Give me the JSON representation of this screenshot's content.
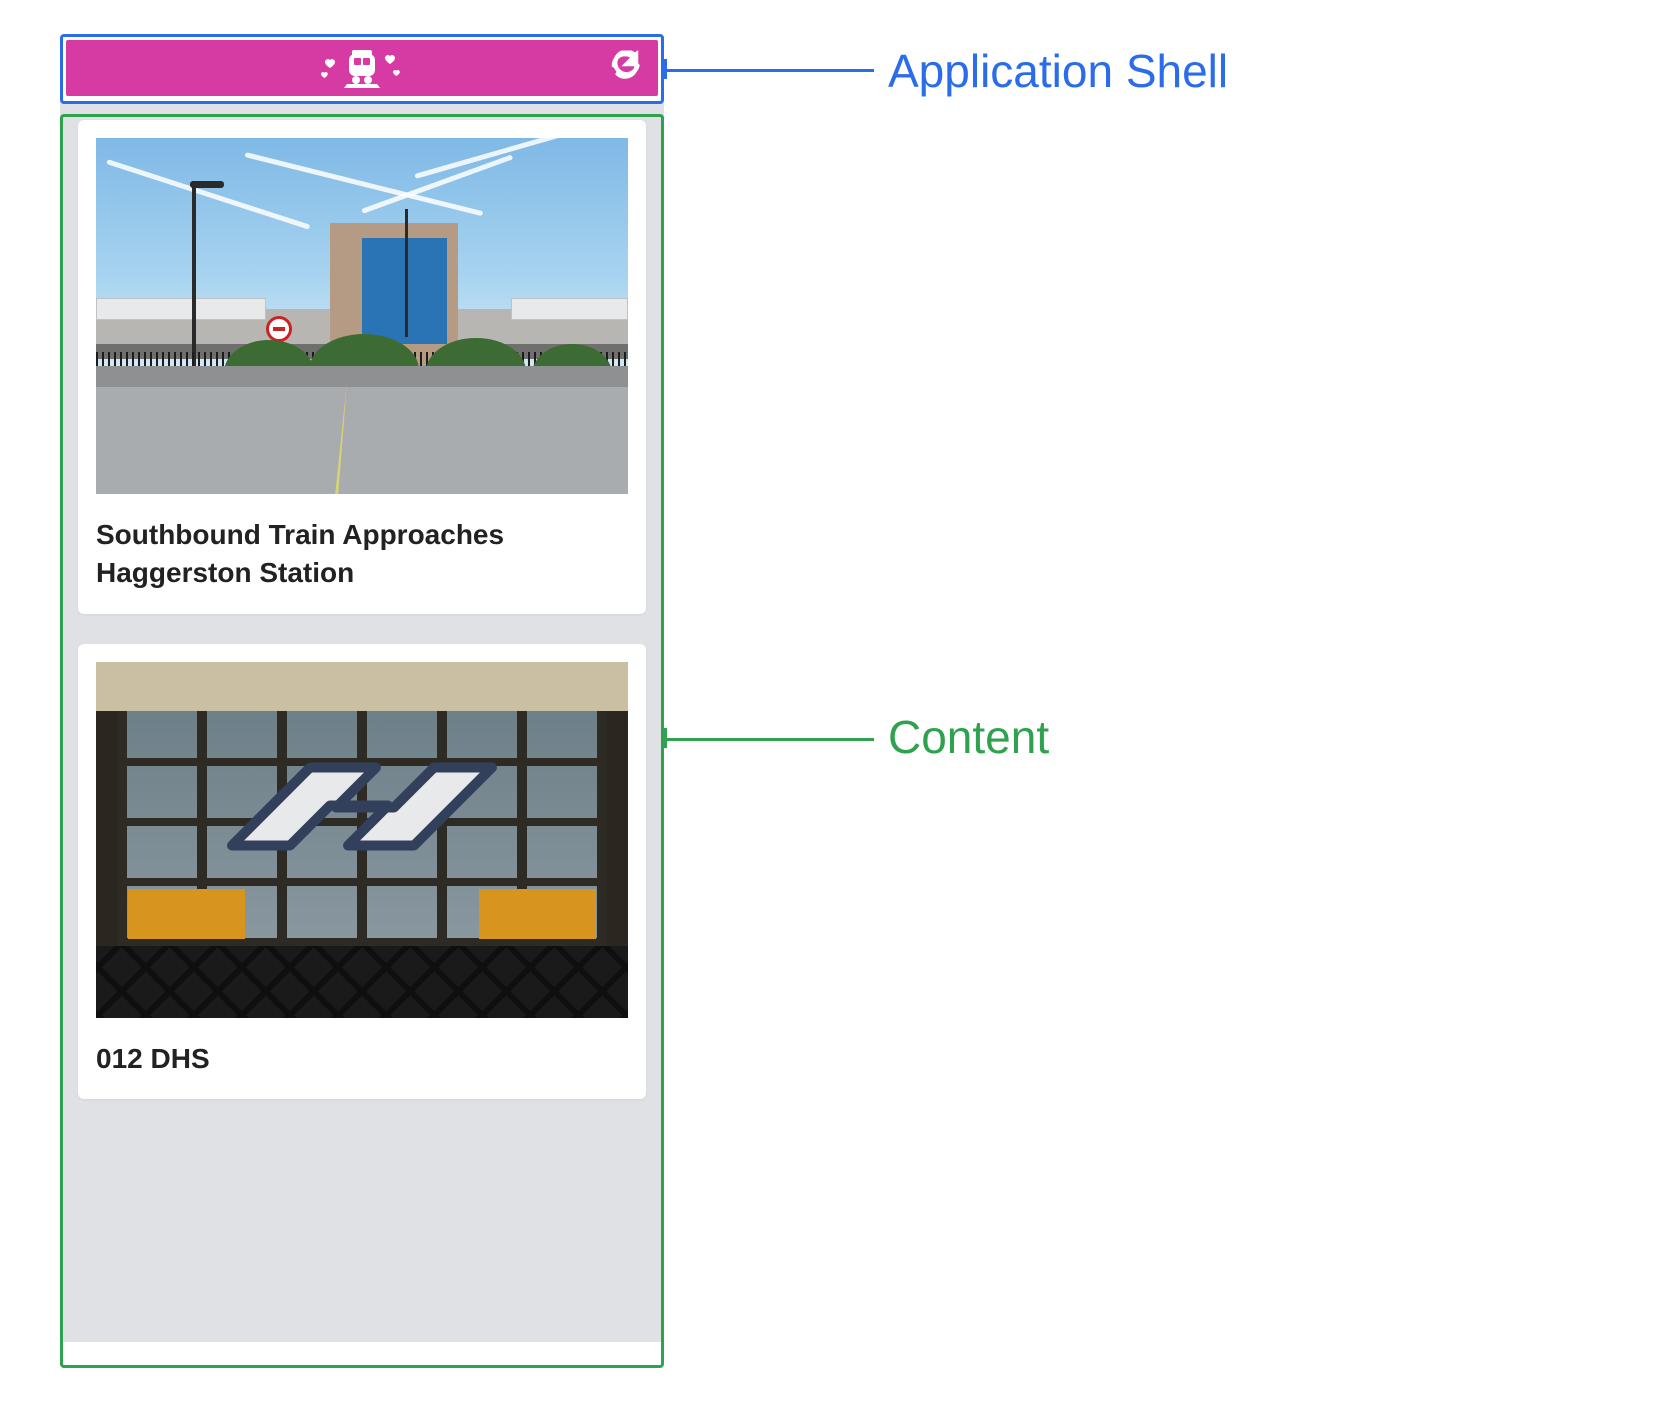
{
  "annotations": {
    "shell_label": "Application Shell",
    "content_label": "Content",
    "colors": {
      "shell": "#2a6cea",
      "content": "#2fa24f",
      "header_bg": "#d63aa3"
    }
  },
  "header": {
    "logo_icon": "train-hearts-icon",
    "refresh_icon": "refresh-icon"
  },
  "cards": [
    {
      "title": "Southbound Train Approaches Haggerston Station"
    },
    {
      "title": "012 DHS"
    }
  ]
}
